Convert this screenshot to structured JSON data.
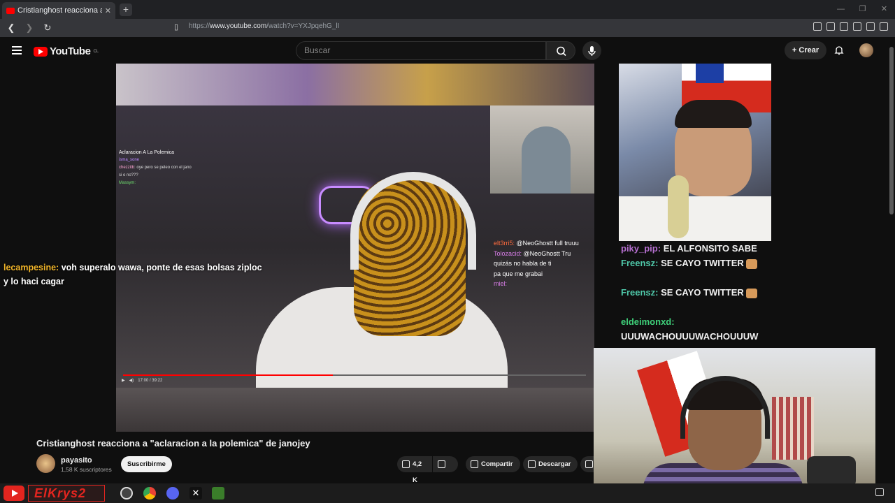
{
  "browser": {
    "tab_title": "Cristianghost reacciona a \"ac",
    "tab_close": "✕",
    "new_tab": "+",
    "url_prefix": "https://",
    "url_domain": "www.youtube.com",
    "url_path": "/watch?v=YXJpqehG_lI",
    "window_controls": [
      "—",
      "❐",
      "✕"
    ]
  },
  "youtube": {
    "logo_text": "YouTube",
    "region": "CL",
    "search_placeholder": "Buscar",
    "create_label": "Crear",
    "create_plus": "+"
  },
  "video": {
    "title": "Cristianghost reacciona a \"aclaracion a la polemica\" de janojey",
    "inner_title": "Aclaracion A La Polemica",
    "time": "17:00 / 39:22",
    "inner_chat": [
      {
        "user": "isma_sone",
        "text": ""
      },
      {
        "user": "chezzitb",
        "text": "oye pero se peleo con el jano"
      },
      {
        "user": "",
        "text": "si o no???"
      },
      {
        "user": "Massym:",
        "text": ""
      }
    ],
    "side_chat": [
      {
        "user": "elt3rri5:",
        "text": "@NeoGhostt full truuu"
      },
      {
        "user": "Tolozacid:",
        "text": "@NeoGhostt Tru"
      },
      {
        "user": "",
        "text": "quizás no habla de ti"
      },
      {
        "user": "",
        "text": "pa que me grabai"
      },
      {
        "user": "miel:",
        "text": ""
      }
    ],
    "overlay_user": "lecampesine:",
    "overlay_text_1": "voh superalo wawa, ponte de esas bolsas ziploc",
    "overlay_text_2": "y lo haci cagar"
  },
  "stream_chat": [
    {
      "user": "piky_pip:",
      "msg": "EL ALFONSITO SABE"
    },
    {
      "user": "Freensz:",
      "msg": "SE CAYO TWITTER"
    },
    {
      "user": "Freensz:",
      "msg": "SE CAYO TWITTER"
    },
    {
      "user": "eldeimonxd:",
      "msg": ""
    },
    {
      "user": "",
      "msg": "UUUWACHOUUUWACHOUUUW"
    }
  ],
  "channel": {
    "name": "payasito",
    "subs": "1,58 K suscriptores",
    "subscribe_label": "Suscribirme"
  },
  "actions": {
    "likes": "4,2 K",
    "share": "Compartir",
    "download": "Descargar"
  },
  "taskbar": {
    "streamer_name": "ElKrys2"
  },
  "colors": {
    "brand_red": "#ff0000",
    "bg": "#0f0f0f",
    "overlay_user": "#f0b429"
  }
}
